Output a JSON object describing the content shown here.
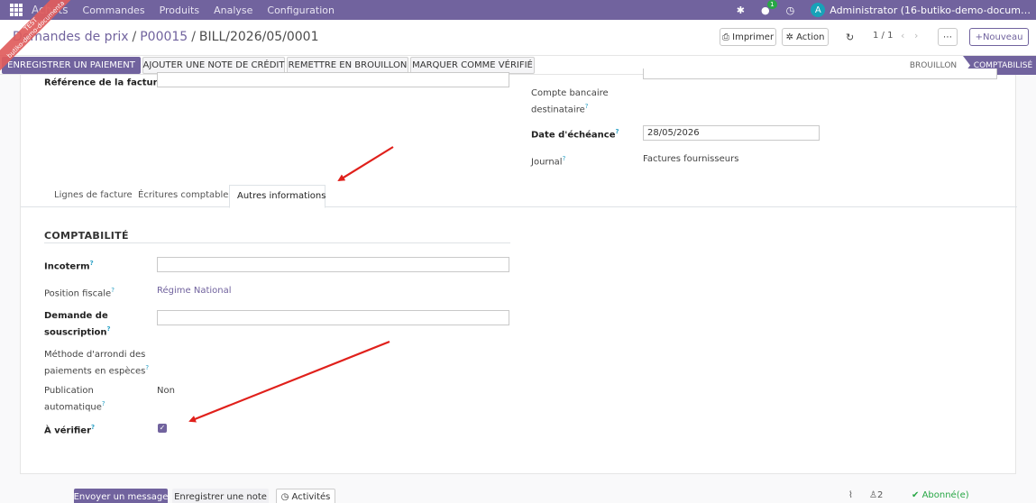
{
  "navbar": {
    "app_name": "Achats",
    "menu": [
      "Commandes",
      "Produits",
      "Analyse",
      "Configuration"
    ],
    "messages_badge": "1",
    "avatar_letter": "A",
    "user": "Administrator (16-butiko-demo-docum…"
  },
  "ribbon": {
    "line1": "TEST",
    "line2": "butiko-demo-documenta"
  },
  "breadcrumb": {
    "parent": "Demandes de prix",
    "middle": "P00015",
    "current": "BILL/2026/05/0001"
  },
  "control": {
    "print_label": "Imprimer",
    "action_label": "Action",
    "pager": "1 / 1",
    "new_label": "Nouveau"
  },
  "statusbar": {
    "buttons": [
      "ENREGISTRER UN PAIEMENT",
      "AJOUTER UNE NOTE DE CRÉDIT",
      "REMETTRE EN BROUILLON",
      "MARQUER COMME VÉRIFIÉ"
    ],
    "stages": [
      "BROUILLON",
      "COMPTABILISÉ"
    ],
    "active_stage": "COMPTABILISÉ"
  },
  "header_fields": {
    "ref_label": "Référence de la facture",
    "bank_label": "Compte bancaire destinataire",
    "due_label": "Date d'échéance",
    "due_value": "28/05/2026",
    "journal_label": "Journal",
    "journal_value": "Factures fournisseurs"
  },
  "tabs": [
    "Lignes de facture",
    "Écritures comptables",
    "Autres informations"
  ],
  "active_tab": "Autres informations",
  "accounting": {
    "title": "COMPTABILITÉ",
    "incoterm_label": "Incoterm",
    "incoterm_value": "",
    "fiscal_label": "Position fiscale",
    "fiscal_value": "Régime National",
    "subscription_label": "Demande de souscription",
    "subscription_value": "",
    "rounding_label": "Méthode d'arrondi des paiements en espèces",
    "autopost_label": "Publication automatique",
    "autopost_value": "Non",
    "to_check_label": "À vérifier",
    "to_check": true
  },
  "chatter": {
    "send_message": "Envoyer un message",
    "log_note": "Enregistrer une note",
    "activities": "Activités",
    "followers_count": "2",
    "follow_label": "Abonné(e)"
  },
  "colors": {
    "brand": "#71639e",
    "annotation_arrow": "#e0201b",
    "success": "#28a745"
  },
  "icons": [
    "apps-grid-icon",
    "bug-icon",
    "chat-icon",
    "clock-icon",
    "print-icon",
    "gear-icon",
    "refresh-icon",
    "chevron-left-icon",
    "chevron-right-icon",
    "ellipsis-icon",
    "plus-icon",
    "paperclip-icon",
    "user-icon",
    "check-icon"
  ]
}
